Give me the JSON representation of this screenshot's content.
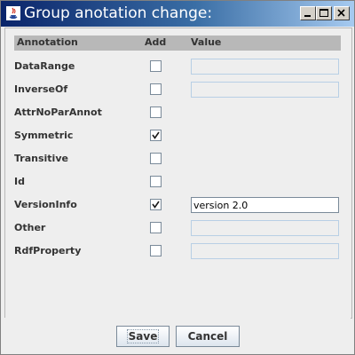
{
  "window": {
    "title": "Group anotation change:"
  },
  "table": {
    "headers": {
      "annotation": "Annotation",
      "add": "Add",
      "value": "Value"
    },
    "rows": [
      {
        "label": "DataRange",
        "checked": false,
        "value": "",
        "has_value_field": true
      },
      {
        "label": "InverseOf",
        "checked": false,
        "value": "",
        "has_value_field": true
      },
      {
        "label": "AttrNoParAnnot",
        "checked": false,
        "value": "",
        "has_value_field": false
      },
      {
        "label": "Symmetric",
        "checked": true,
        "value": "",
        "has_value_field": false
      },
      {
        "label": "Transitive",
        "checked": false,
        "value": "",
        "has_value_field": false
      },
      {
        "label": "Id",
        "checked": false,
        "value": "",
        "has_value_field": false
      },
      {
        "label": "VersionInfo",
        "checked": true,
        "value": "version 2.0",
        "has_value_field": true
      },
      {
        "label": "Other",
        "checked": false,
        "value": "",
        "has_value_field": true
      },
      {
        "label": "RdfProperty",
        "checked": false,
        "value": "",
        "has_value_field": true
      }
    ]
  },
  "footer": {
    "save_label": "Save",
    "cancel_label": "Cancel"
  }
}
